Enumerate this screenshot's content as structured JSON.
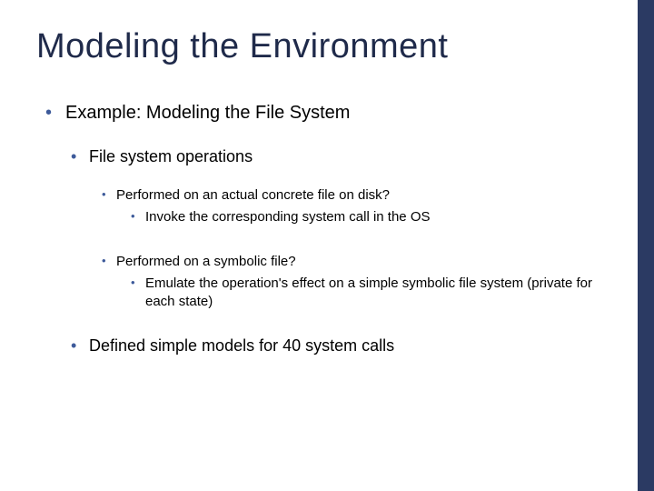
{
  "title": "Modeling the Environment",
  "bullets": {
    "l1_example": "Example: Modeling the File System",
    "l2_ops": "File system operations",
    "l3_concrete": "Performed on an actual concrete file on disk?",
    "l4_concrete_sub": "Invoke the corresponding system call in the OS",
    "l3_symbolic": "Performed on a symbolic file?",
    "l4_symbolic_sub": "Emulate the operation's effect on a simple symbolic file system (private for each state)",
    "l2_defined": "Defined simple models for 40 system calls"
  },
  "accent_color": "#2b3a63"
}
